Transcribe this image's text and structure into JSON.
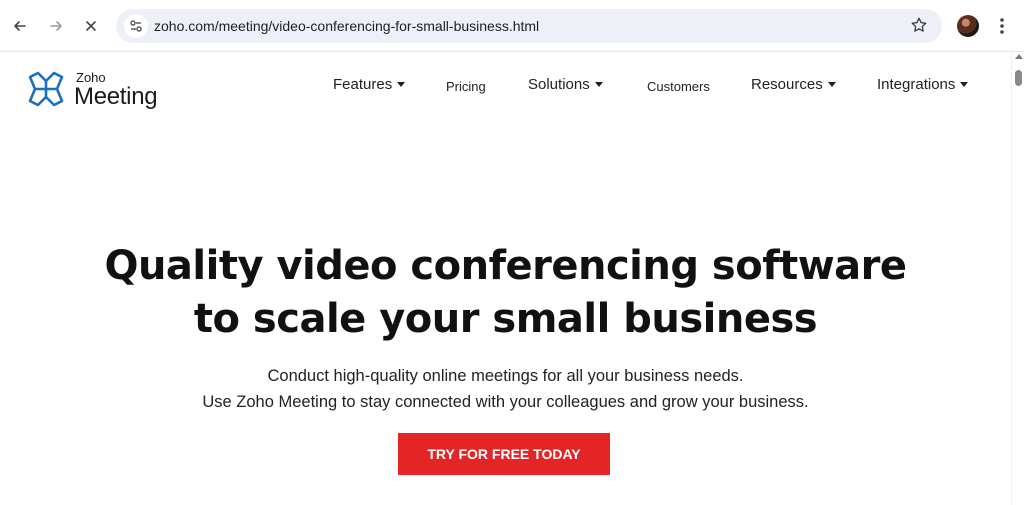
{
  "browser": {
    "url": "zoho.com/meeting/video-conferencing-for-small-business.html"
  },
  "logo": {
    "brand": "Zoho",
    "product": "Meeting"
  },
  "nav": {
    "features": "Features",
    "pricing": "Pricing",
    "solutions": "Solutions",
    "customers": "Customers",
    "resources": "Resources",
    "integrations": "Integrations"
  },
  "hero": {
    "headline_line1": "Quality video conferencing software",
    "headline_line2": "to scale your small business",
    "sub_line1": "Conduct high-quality online meetings for all your business needs.",
    "sub_line2": "Use Zoho Meeting to stay connected with your colleagues and grow your business.",
    "cta_label": "TRY FOR FREE TODAY"
  },
  "colors": {
    "cta": "#e42527",
    "logo_blue": "#1b6ec2",
    "omnibox": "#eef0f7"
  }
}
